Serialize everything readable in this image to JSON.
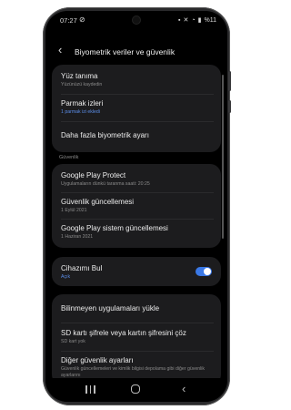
{
  "status_bar": {
    "time": "07:27",
    "battery": "%11"
  },
  "header": {
    "back_label": "‹",
    "title": "Biyometrik veriler ve güvenlik"
  },
  "biometrics": [
    {
      "title": "Yüz tanıma",
      "subtitle": "Yüzünüzü kaydedin",
      "subtitle_color": "gray"
    },
    {
      "title": "Parmak izleri",
      "subtitle": "1 parmak izi ekledi",
      "subtitle_color": "blue"
    },
    {
      "title": "Daha fazla biyometrik ayarı",
      "subtitle": ""
    }
  ],
  "security_section_label": "Güvenlik",
  "security": [
    {
      "title": "Google Play Protect",
      "subtitle": "Uygulamaların dünkü taranma saati: 20:25"
    },
    {
      "title": "Güvenlik güncellemesi",
      "subtitle": "1 Eylül 2021"
    },
    {
      "title": "Google Play sistem güncellemesi",
      "subtitle": "1 Haziran 2021"
    }
  ],
  "find_device": {
    "title": "Cihazımı Bul",
    "subtitle": "Açık",
    "enabled": true
  },
  "other": [
    {
      "title": "Bilinmeyen uygulamaları yükle",
      "subtitle": ""
    },
    {
      "title": "SD kartı şifrele veya kartın şifresini çöz",
      "subtitle": "SD kart yok"
    },
    {
      "title": "Diğer güvenlik ayarları",
      "subtitle": "Güvenlik güncellemeleri ve kimlik bilgisi depolama gibi diğer güvenlik ayarlarını"
    }
  ],
  "colors": {
    "accent": "#3a78e6",
    "card": "#1c1c1e",
    "background": "#000000"
  }
}
